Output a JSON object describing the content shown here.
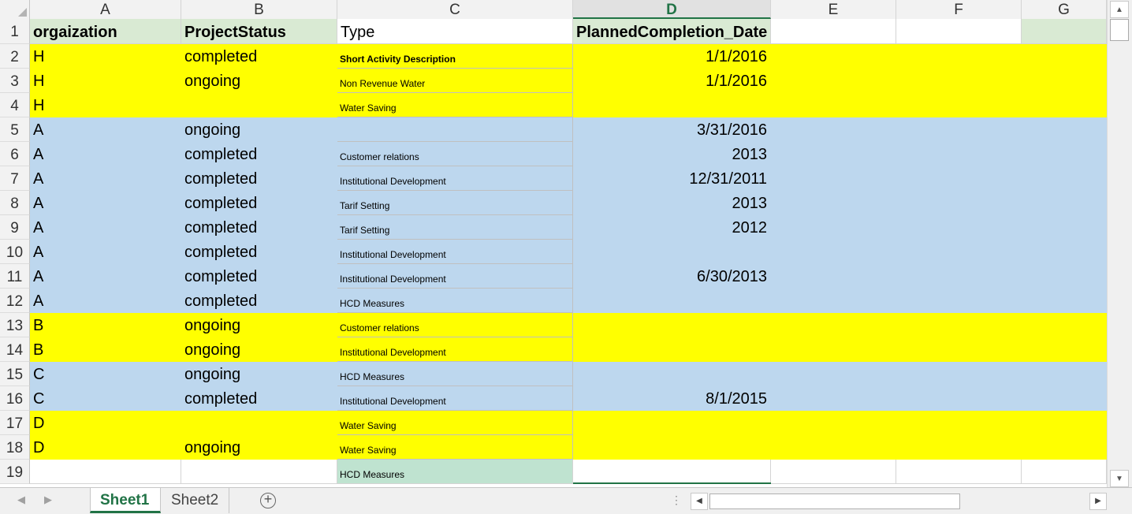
{
  "columns": [
    "A",
    "B",
    "C",
    "D",
    "E",
    "F",
    "G"
  ],
  "selected_column": "D",
  "rows": [
    {
      "n": "1",
      "a": "orgaization",
      "b": "ProjectStatus",
      "c": "Type",
      "d": "PlannedCompletion_Date",
      "e": ""
    },
    {
      "n": "2",
      "a": "H",
      "b": "completed",
      "c": "Short Activity Description",
      "d": "1/1/2016",
      "e": ""
    },
    {
      "n": "3",
      "a": "H",
      "b": "ongoing",
      "c": "Non Revenue Water",
      "d": "1/1/2016",
      "e": ""
    },
    {
      "n": "4",
      "a": "H",
      "b": "",
      "c": "Water Saving",
      "d": "",
      "e": ""
    },
    {
      "n": "5",
      "a": "A",
      "b": "ongoing",
      "c": "",
      "d": "3/31/2016",
      "e": ""
    },
    {
      "n": "6",
      "a": "A",
      "b": "completed",
      "c": "Customer relations",
      "d": "2013",
      "e": ""
    },
    {
      "n": "7",
      "a": "A",
      "b": "completed",
      "c": "Institutional Development",
      "d": "12/31/2011",
      "e": ""
    },
    {
      "n": "8",
      "a": "A",
      "b": "completed",
      "c": "Tarif Setting",
      "d": "2013",
      "e": ""
    },
    {
      "n": "9",
      "a": "A",
      "b": "completed",
      "c": "Tarif Setting",
      "d": "2012",
      "e": ""
    },
    {
      "n": "10",
      "a": "A",
      "b": "completed",
      "c": "Institutional Development",
      "d": "",
      "e": ""
    },
    {
      "n": "11",
      "a": "A",
      "b": "completed",
      "c": "Institutional Development",
      "d": "6/30/2013",
      "e": ""
    },
    {
      "n": "12",
      "a": "A",
      "b": "completed",
      "c": "HCD Measures",
      "d": "",
      "e": ""
    },
    {
      "n": "13",
      "a": "B",
      "b": "ongoing",
      "c": "Customer relations",
      "d": "",
      "e": ""
    },
    {
      "n": "14",
      "a": "B",
      "b": "ongoing",
      "c": "Institutional Development",
      "d": "",
      "e": ""
    },
    {
      "n": "15",
      "a": "C",
      "b": "ongoing",
      "c": "HCD Measures",
      "d": "",
      "e": ""
    },
    {
      "n": "16",
      "a": "C",
      "b": "completed",
      "c": "Institutional Development",
      "d": "8/1/2015",
      "e": ""
    },
    {
      "n": "17",
      "a": "D",
      "b": "",
      "c": "Water Saving",
      "d": "",
      "e": ""
    },
    {
      "n": "18",
      "a": "D",
      "b": "ongoing",
      "c": "Water Saving",
      "d": "",
      "e": ""
    },
    {
      "n": "19",
      "a": "",
      "b": "",
      "c": "HCD Measures",
      "d": "",
      "e": ""
    }
  ],
  "sheet_tabs": [
    {
      "label": "Sheet1",
      "active": true
    },
    {
      "label": "Sheet2",
      "active": false
    }
  ],
  "colors": {
    "yellow": "#ffff00",
    "blue": "#bdd7ee",
    "green_header": "#d9ead3",
    "excel_green": "#217346"
  }
}
